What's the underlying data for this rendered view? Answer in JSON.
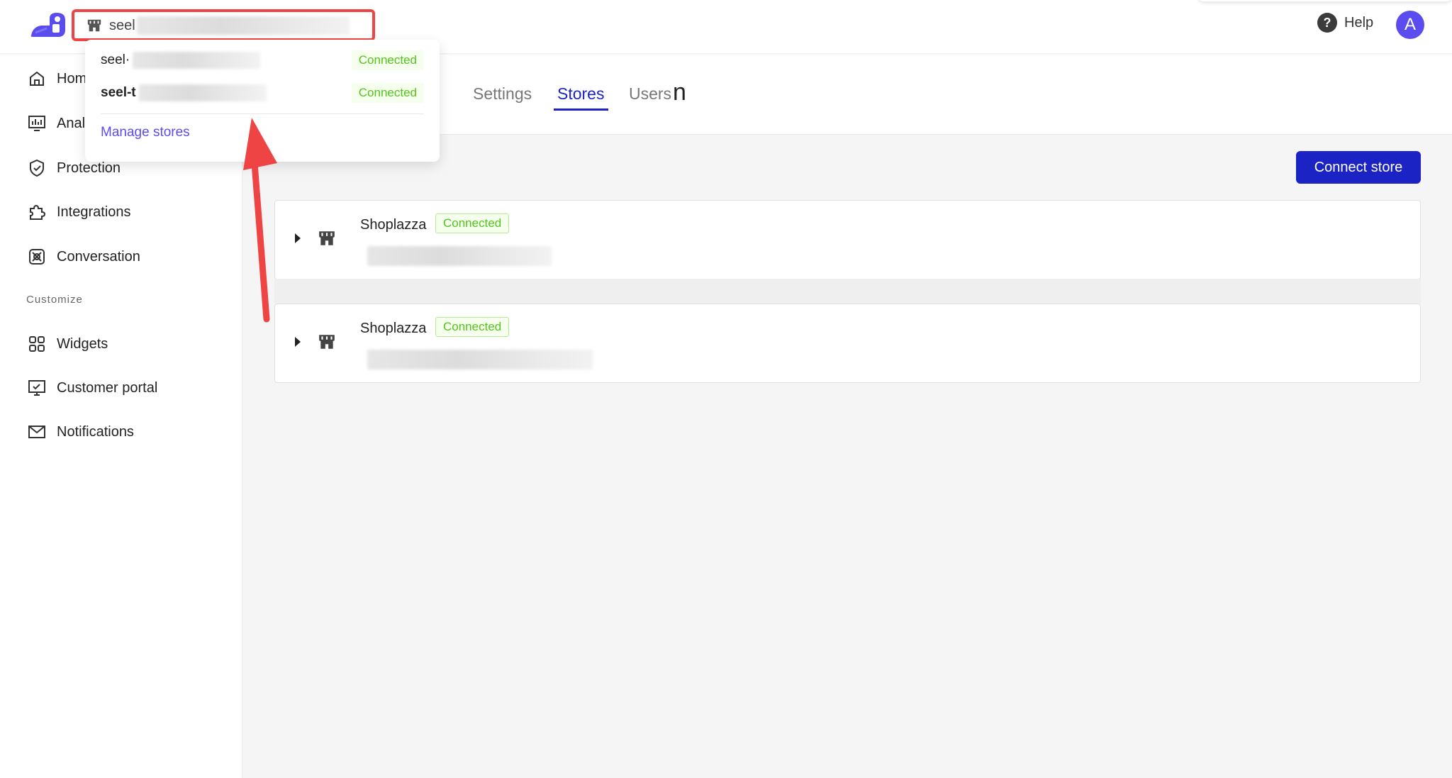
{
  "topbar": {
    "store_name_visible": "seel",
    "help_label": "Help",
    "avatar_initial": "A"
  },
  "dropdown": {
    "items": [
      {
        "name": "seel·",
        "status": "Connected"
      },
      {
        "name": "seel-t",
        "status": "Connected"
      }
    ],
    "manage_label": "Manage stores"
  },
  "sidebar": {
    "items": [
      {
        "label": "Hom"
      },
      {
        "label": "Anal"
      },
      {
        "label": "Protection"
      },
      {
        "label": "Integrations"
      },
      {
        "label": "Conversation"
      }
    ],
    "section_label": "Customize",
    "customize_items": [
      {
        "label": "Widgets"
      },
      {
        "label": "Customer portal"
      },
      {
        "label": "Notifications"
      }
    ]
  },
  "tabs": {
    "partial_title": "n",
    "items": [
      {
        "label": "Settings"
      },
      {
        "label": "Stores"
      },
      {
        "label": "Users"
      }
    ],
    "active": "Stores"
  },
  "content": {
    "connect_button": "Connect store",
    "stores": [
      {
        "platform": "Shoplazza",
        "status": "Connected"
      },
      {
        "platform": "Shoplazza",
        "status": "Connected"
      }
    ]
  },
  "colors": {
    "accent": "#1c23c5",
    "brand": "#5b4cf0",
    "success": "#52c41a",
    "annotation": "#ef4444"
  }
}
